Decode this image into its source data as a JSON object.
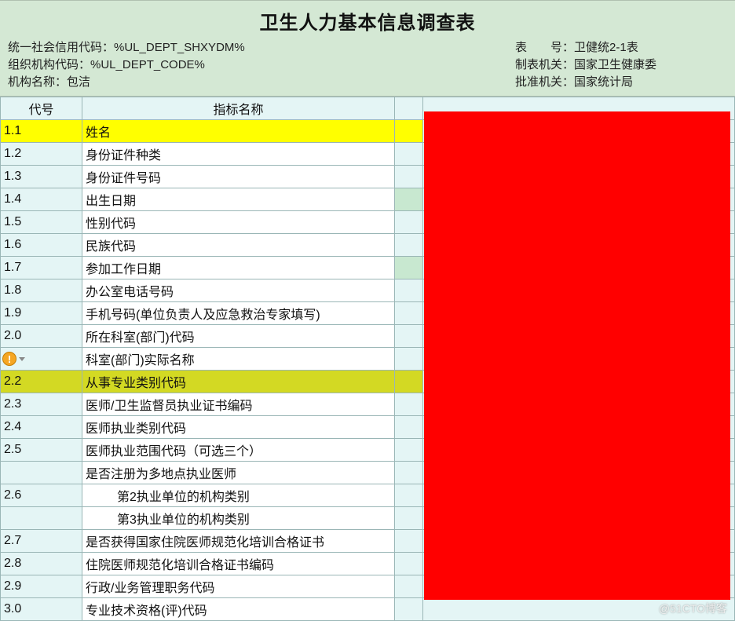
{
  "title": "卫生人力基本信息调查表",
  "meta_left": {
    "l1_label": "统一社会信用代码：",
    "l1_value": "%UL_DEPT_SHXYDM%",
    "l2_label": "组织机构代码：",
    "l2_value": "%UL_DEPT_CODE%",
    "l3_label": "机构名称：",
    "l3_value": "包洁"
  },
  "meta_right": {
    "r1_label": "表　　号：",
    "r1_value": "卫健统2-1表",
    "r2_label": "制表机关：",
    "r2_value": "国家卫生健康委",
    "r3_label": "批准机关：",
    "r3_value": "国家统计局"
  },
  "columns": {
    "code": "代号",
    "name": "指标名称"
  },
  "rows": [
    {
      "code": "1.1",
      "name": "姓名",
      "hl": "yellow"
    },
    {
      "code": "1.2",
      "name": "身份证件种类"
    },
    {
      "code": "1.3",
      "name": "身份证件号码"
    },
    {
      "code": "1.4",
      "name": "出生日期",
      "hl": "green"
    },
    {
      "code": "1.5",
      "name": "性别代码"
    },
    {
      "code": "1.6",
      "name": "民族代码"
    },
    {
      "code": "1.7",
      "name": "参加工作日期",
      "hl": "green"
    },
    {
      "code": "1.8",
      "name": "办公室电话号码"
    },
    {
      "code": "1.9",
      "name": "手机号码(单位负责人及应急救治专家填写)"
    },
    {
      "code": "2.0",
      "name": "所在科室(部门)代码"
    },
    {
      "code": "",
      "name": "科室(部门)实际名称",
      "warn": true
    },
    {
      "code": "2.2",
      "name": "从事专业类别代码",
      "hl": "olive"
    },
    {
      "code": "2.3",
      "name": "医师/卫生监督员执业证书编码"
    },
    {
      "code": "2.4",
      "name": "医师执业类别代码"
    },
    {
      "code": "2.5",
      "name": "医师执业范围代码（可选三个）"
    },
    {
      "code": "",
      "name": "是否注册为多地点执业医师"
    },
    {
      "code": "2.6",
      "name": "第2执业单位的机构类别",
      "indent": 2
    },
    {
      "code": "",
      "name": "第3执业单位的机构类别",
      "indent": 2
    },
    {
      "code": "2.7",
      "name": "是否获得国家住院医师规范化培训合格证书"
    },
    {
      "code": "2.8",
      "name": "住院医师规范化培训合格证书编码"
    },
    {
      "code": "2.9",
      "name": "行政/业务管理职务代码"
    },
    {
      "code": "3.0",
      "name": "专业技术资格(评)代码"
    }
  ],
  "watermark": "@51CTO博客",
  "chart_data": {
    "type": "table",
    "title": "卫生人力基本信息调查表",
    "columns": [
      "代号",
      "指标名称"
    ],
    "data": [
      [
        "1.1",
        "姓名"
      ],
      [
        "1.2",
        "身份证件种类"
      ],
      [
        "1.3",
        "身份证件号码"
      ],
      [
        "1.4",
        "出生日期"
      ],
      [
        "1.5",
        "性别代码"
      ],
      [
        "1.6",
        "民族代码"
      ],
      [
        "1.7",
        "参加工作日期"
      ],
      [
        "1.8",
        "办公室电话号码"
      ],
      [
        "1.9",
        "手机号码(单位负责人及应急救治专家填写)"
      ],
      [
        "2.0",
        "所在科室(部门)代码"
      ],
      [
        "",
        "科室(部门)实际名称"
      ],
      [
        "2.2",
        "从事专业类别代码"
      ],
      [
        "2.3",
        "医师/卫生监督员执业证书编码"
      ],
      [
        "2.4",
        "医师执业类别代码"
      ],
      [
        "2.5",
        "医师执业范围代码（可选三个）"
      ],
      [
        "",
        "是否注册为多地点执业医师"
      ],
      [
        "2.6",
        "第2执业单位的机构类别"
      ],
      [
        "",
        "第3执业单位的机构类别"
      ],
      [
        "2.7",
        "是否获得国家住院医师规范化培训合格证书"
      ],
      [
        "2.8",
        "住院医师规范化培训合格证书编码"
      ],
      [
        "2.9",
        "行政/业务管理职务代码"
      ],
      [
        "3.0",
        "专业技术资格(评)代码"
      ]
    ]
  }
}
